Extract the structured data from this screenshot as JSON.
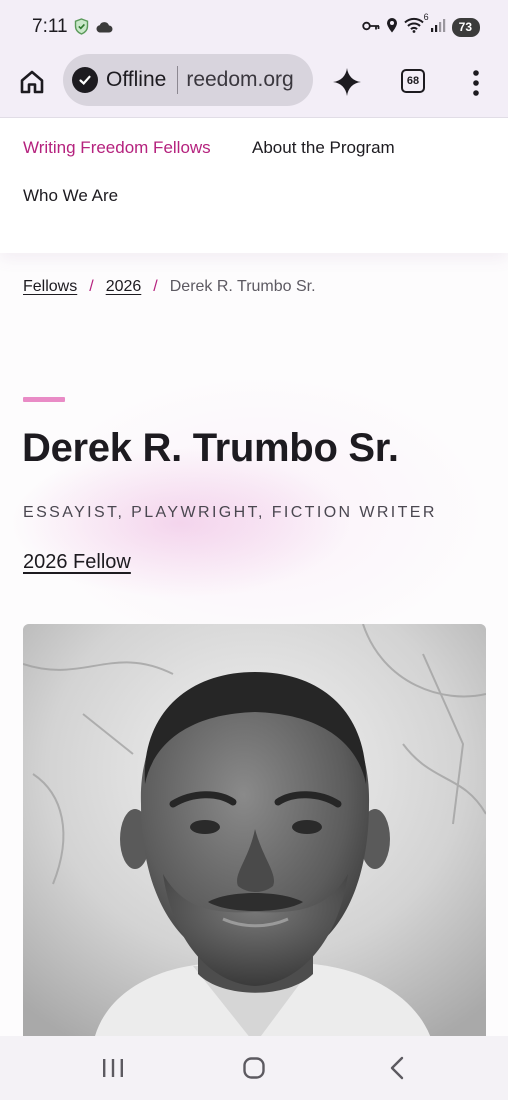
{
  "status_bar": {
    "time": "7:11",
    "battery_level": "73",
    "signal_label": "6",
    "icons": [
      "shield-check-icon",
      "cloud-icon",
      "key-icon",
      "location-pin-icon",
      "wifi-icon",
      "signal-bars-icon",
      "battery-icon"
    ]
  },
  "browser": {
    "offline_label": "Offline",
    "url_text": "reedom.org",
    "tab_count": "68",
    "icons": [
      "home-icon",
      "offline-check-icon",
      "gemini-sparkle-icon",
      "tab-switcher-icon",
      "more-vertical-icon"
    ]
  },
  "site_nav": {
    "items": [
      {
        "label": "Writing Freedom Fellows",
        "active": true
      },
      {
        "label": "About the Program",
        "active": false
      },
      {
        "label": "Who We Are",
        "active": false
      }
    ],
    "active_color": "#b5227e"
  },
  "breadcrumb": {
    "items": [
      "Fellows",
      "2026",
      "Derek R. Trumbo Sr."
    ],
    "separator": "/"
  },
  "profile": {
    "name": "Derek R. Trumbo Sr.",
    "roles": "ESSAYIST, PLAYWRIGHT, FICTION WRITER",
    "fellow_link": "2026 Fellow",
    "accent_color": "#e98bc6",
    "photo_description": "black-and-white-portrait"
  },
  "system_nav": {
    "icons": [
      "recent-apps-icon",
      "home-circle-icon",
      "back-icon"
    ]
  }
}
